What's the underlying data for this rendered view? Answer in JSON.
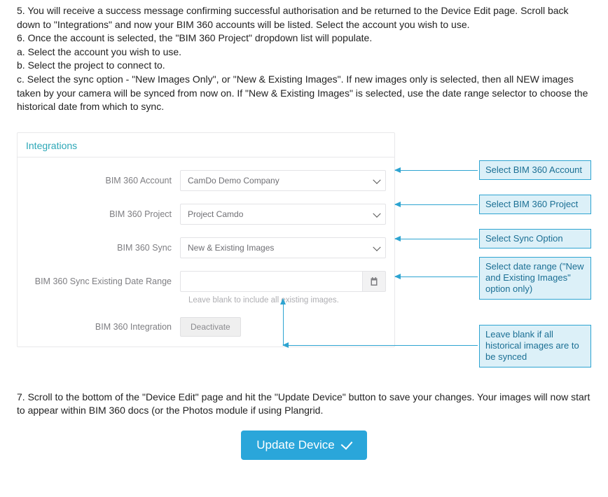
{
  "instructions": {
    "p5": "5. You will receive a success message confirming successful authorisation and be returned to the Device Edit page. Scroll back down to \"Integrations\" and now your BIM 360 accounts will be listed. Select the account you wish to use.",
    "p6": "6. Once the account is selected, the \"BIM 360 Project\" dropdown list will populate.",
    "p6a": "a. Select the account you wish to use.",
    "p6b": "b. Select the project to connect to.",
    "p6c": "c. Select the sync option - \"New Images Only\", or \"New & Existing Images\". If new images only is selected, then all NEW images taken by your camera will be synced from now on. If \"New & Existing Images\" is selected, use the date range selector to choose the historical date from which to sync.",
    "p7": "7. Scroll to the bottom of the \"Device Edit\" page and hit the \"Update Device\" button to save your changes. Your images will now start to appear within BIM 360 docs (or the Photos module if using Plangrid."
  },
  "panel": {
    "title": "Integrations",
    "account_label": "BIM 360 Account",
    "account_value": "CamDo Demo Company",
    "project_label": "BIM 360 Project",
    "project_value": "Project Camdo",
    "sync_label": "BIM 360 Sync",
    "sync_value": "New & Existing Images",
    "date_label": "BIM 360 Sync Existing Date Range",
    "date_value": "",
    "date_helper": "Leave blank to include all existing images.",
    "integration_label": "BIM 360 Integration",
    "deactivate_label": "Deactivate"
  },
  "callouts": {
    "account": "Select BIM 360 Account",
    "project": "Select BIM 360 Project",
    "sync": "Select Sync Option",
    "date": "Select date range (\"New and Existing Images\" option only)",
    "blank": "Leave blank if all historical images are to be synced"
  },
  "update_button": "Update Device"
}
